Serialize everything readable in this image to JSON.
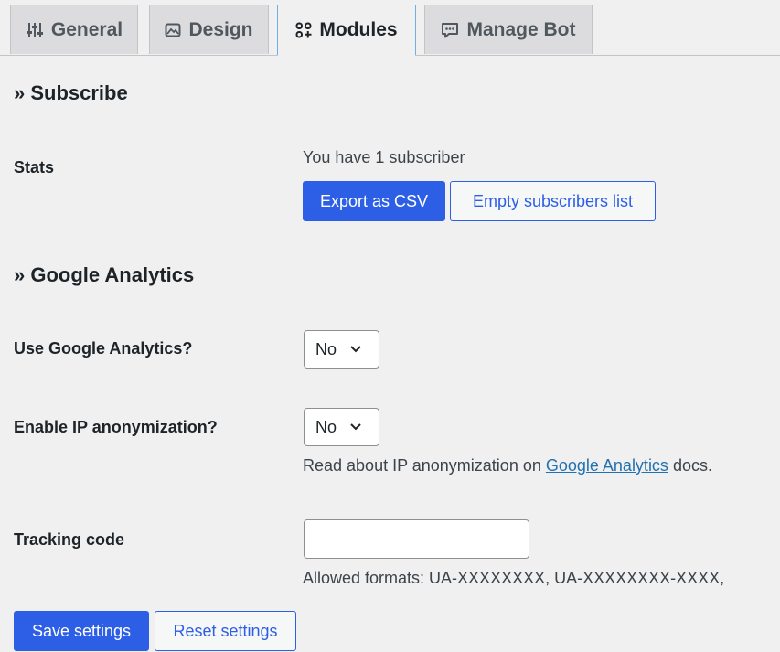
{
  "tabs": [
    {
      "label": "General",
      "icon": "sliders-icon"
    },
    {
      "label": "Design",
      "icon": "image-icon"
    },
    {
      "label": "Modules",
      "icon": "modules-icon"
    },
    {
      "label": "Manage Bot",
      "icon": "chat-icon"
    }
  ],
  "active_tab": "Modules",
  "subscribe": {
    "heading": "» Subscribe",
    "stats_label": "Stats",
    "count_text": "You have 1 subscriber",
    "export_label": "Export as CSV",
    "empty_label": "Empty subscribers list"
  },
  "analytics": {
    "heading": "» Google Analytics",
    "use_label": "Use Google Analytics?",
    "use_value": "No",
    "anon_label": "Enable IP anonymization?",
    "anon_value": "No",
    "anon_note_prefix": "Read about IP anonymization on ",
    "anon_note_link": "Google Analytics",
    "anon_note_suffix": " docs.",
    "tracking_label": "Tracking code",
    "tracking_value": "",
    "tracking_note": "Allowed formats: UA-XXXXXXXX, UA-XXXXXXXX-XXXX,"
  },
  "footer": {
    "save_label": "Save settings",
    "reset_label": "Reset settings"
  },
  "colors": {
    "primary": "#2c5fe6",
    "link": "#2271b1",
    "background": "#f0f0f1"
  }
}
